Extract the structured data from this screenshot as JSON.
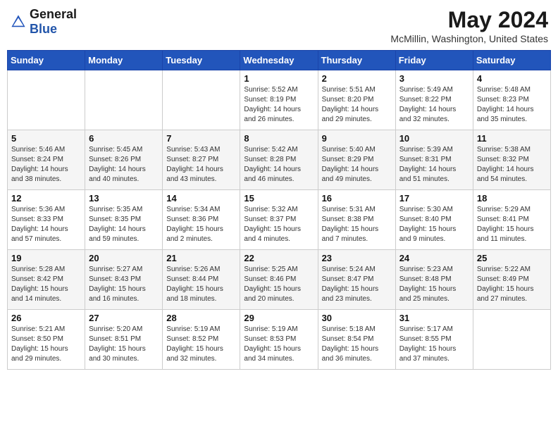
{
  "header": {
    "logo_general": "General",
    "logo_blue": "Blue",
    "month_title": "May 2024",
    "location": "McMillin, Washington, United States"
  },
  "weekdays": [
    "Sunday",
    "Monday",
    "Tuesday",
    "Wednesday",
    "Thursday",
    "Friday",
    "Saturday"
  ],
  "weeks": [
    [
      {
        "day": "",
        "sunrise": "",
        "sunset": "",
        "daylight": ""
      },
      {
        "day": "",
        "sunrise": "",
        "sunset": "",
        "daylight": ""
      },
      {
        "day": "",
        "sunrise": "",
        "sunset": "",
        "daylight": ""
      },
      {
        "day": "1",
        "sunrise": "Sunrise: 5:52 AM",
        "sunset": "Sunset: 8:19 PM",
        "daylight": "Daylight: 14 hours and 26 minutes."
      },
      {
        "day": "2",
        "sunrise": "Sunrise: 5:51 AM",
        "sunset": "Sunset: 8:20 PM",
        "daylight": "Daylight: 14 hours and 29 minutes."
      },
      {
        "day": "3",
        "sunrise": "Sunrise: 5:49 AM",
        "sunset": "Sunset: 8:22 PM",
        "daylight": "Daylight: 14 hours and 32 minutes."
      },
      {
        "day": "4",
        "sunrise": "Sunrise: 5:48 AM",
        "sunset": "Sunset: 8:23 PM",
        "daylight": "Daylight: 14 hours and 35 minutes."
      }
    ],
    [
      {
        "day": "5",
        "sunrise": "Sunrise: 5:46 AM",
        "sunset": "Sunset: 8:24 PM",
        "daylight": "Daylight: 14 hours and 38 minutes."
      },
      {
        "day": "6",
        "sunrise": "Sunrise: 5:45 AM",
        "sunset": "Sunset: 8:26 PM",
        "daylight": "Daylight: 14 hours and 40 minutes."
      },
      {
        "day": "7",
        "sunrise": "Sunrise: 5:43 AM",
        "sunset": "Sunset: 8:27 PM",
        "daylight": "Daylight: 14 hours and 43 minutes."
      },
      {
        "day": "8",
        "sunrise": "Sunrise: 5:42 AM",
        "sunset": "Sunset: 8:28 PM",
        "daylight": "Daylight: 14 hours and 46 minutes."
      },
      {
        "day": "9",
        "sunrise": "Sunrise: 5:40 AM",
        "sunset": "Sunset: 8:29 PM",
        "daylight": "Daylight: 14 hours and 49 minutes."
      },
      {
        "day": "10",
        "sunrise": "Sunrise: 5:39 AM",
        "sunset": "Sunset: 8:31 PM",
        "daylight": "Daylight: 14 hours and 51 minutes."
      },
      {
        "day": "11",
        "sunrise": "Sunrise: 5:38 AM",
        "sunset": "Sunset: 8:32 PM",
        "daylight": "Daylight: 14 hours and 54 minutes."
      }
    ],
    [
      {
        "day": "12",
        "sunrise": "Sunrise: 5:36 AM",
        "sunset": "Sunset: 8:33 PM",
        "daylight": "Daylight: 14 hours and 57 minutes."
      },
      {
        "day": "13",
        "sunrise": "Sunrise: 5:35 AM",
        "sunset": "Sunset: 8:35 PM",
        "daylight": "Daylight: 14 hours and 59 minutes."
      },
      {
        "day": "14",
        "sunrise": "Sunrise: 5:34 AM",
        "sunset": "Sunset: 8:36 PM",
        "daylight": "Daylight: 15 hours and 2 minutes."
      },
      {
        "day": "15",
        "sunrise": "Sunrise: 5:32 AM",
        "sunset": "Sunset: 8:37 PM",
        "daylight": "Daylight: 15 hours and 4 minutes."
      },
      {
        "day": "16",
        "sunrise": "Sunrise: 5:31 AM",
        "sunset": "Sunset: 8:38 PM",
        "daylight": "Daylight: 15 hours and 7 minutes."
      },
      {
        "day": "17",
        "sunrise": "Sunrise: 5:30 AM",
        "sunset": "Sunset: 8:40 PM",
        "daylight": "Daylight: 15 hours and 9 minutes."
      },
      {
        "day": "18",
        "sunrise": "Sunrise: 5:29 AM",
        "sunset": "Sunset: 8:41 PM",
        "daylight": "Daylight: 15 hours and 11 minutes."
      }
    ],
    [
      {
        "day": "19",
        "sunrise": "Sunrise: 5:28 AM",
        "sunset": "Sunset: 8:42 PM",
        "daylight": "Daylight: 15 hours and 14 minutes."
      },
      {
        "day": "20",
        "sunrise": "Sunrise: 5:27 AM",
        "sunset": "Sunset: 8:43 PM",
        "daylight": "Daylight: 15 hours and 16 minutes."
      },
      {
        "day": "21",
        "sunrise": "Sunrise: 5:26 AM",
        "sunset": "Sunset: 8:44 PM",
        "daylight": "Daylight: 15 hours and 18 minutes."
      },
      {
        "day": "22",
        "sunrise": "Sunrise: 5:25 AM",
        "sunset": "Sunset: 8:46 PM",
        "daylight": "Daylight: 15 hours and 20 minutes."
      },
      {
        "day": "23",
        "sunrise": "Sunrise: 5:24 AM",
        "sunset": "Sunset: 8:47 PM",
        "daylight": "Daylight: 15 hours and 23 minutes."
      },
      {
        "day": "24",
        "sunrise": "Sunrise: 5:23 AM",
        "sunset": "Sunset: 8:48 PM",
        "daylight": "Daylight: 15 hours and 25 minutes."
      },
      {
        "day": "25",
        "sunrise": "Sunrise: 5:22 AM",
        "sunset": "Sunset: 8:49 PM",
        "daylight": "Daylight: 15 hours and 27 minutes."
      }
    ],
    [
      {
        "day": "26",
        "sunrise": "Sunrise: 5:21 AM",
        "sunset": "Sunset: 8:50 PM",
        "daylight": "Daylight: 15 hours and 29 minutes."
      },
      {
        "day": "27",
        "sunrise": "Sunrise: 5:20 AM",
        "sunset": "Sunset: 8:51 PM",
        "daylight": "Daylight: 15 hours and 30 minutes."
      },
      {
        "day": "28",
        "sunrise": "Sunrise: 5:19 AM",
        "sunset": "Sunset: 8:52 PM",
        "daylight": "Daylight: 15 hours and 32 minutes."
      },
      {
        "day": "29",
        "sunrise": "Sunrise: 5:19 AM",
        "sunset": "Sunset: 8:53 PM",
        "daylight": "Daylight: 15 hours and 34 minutes."
      },
      {
        "day": "30",
        "sunrise": "Sunrise: 5:18 AM",
        "sunset": "Sunset: 8:54 PM",
        "daylight": "Daylight: 15 hours and 36 minutes."
      },
      {
        "day": "31",
        "sunrise": "Sunrise: 5:17 AM",
        "sunset": "Sunset: 8:55 PM",
        "daylight": "Daylight: 15 hours and 37 minutes."
      },
      {
        "day": "",
        "sunrise": "",
        "sunset": "",
        "daylight": ""
      }
    ]
  ]
}
